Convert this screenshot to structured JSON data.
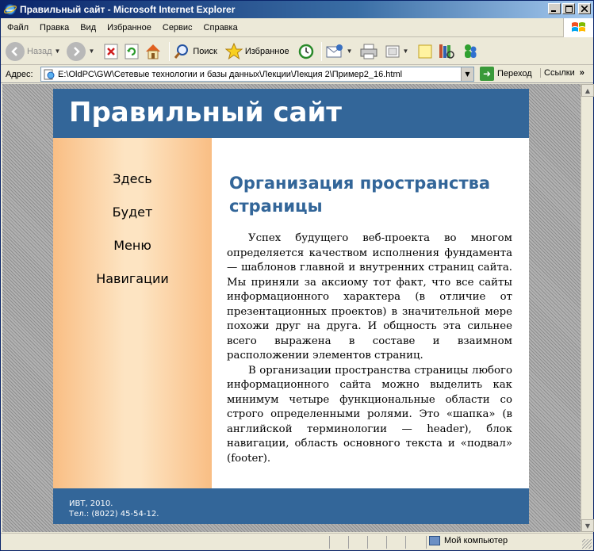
{
  "window": {
    "title": "Правильный сайт - Microsoft Internet Explorer"
  },
  "menu": {
    "items": [
      "Файл",
      "Правка",
      "Вид",
      "Избранное",
      "Сервис",
      "Справка"
    ]
  },
  "toolbar": {
    "back_label": "Назад",
    "search_label": "Поиск",
    "favorites_label": "Избранное"
  },
  "address": {
    "label": "Адрес:",
    "url": "E:\\OldPC\\GW\\Сетевые технологии и базы данных\\Лекции\\Лекция 2\\Пример2_16.html",
    "go_label": "Переход",
    "links_label": "Ссылки"
  },
  "page": {
    "header_title": "Правильный сайт",
    "nav": [
      "Здесь",
      "Будет",
      "Меню",
      "Навигации"
    ],
    "heading": "Организация пространства страницы",
    "paragraphs": [
      "Успех будущего веб-проекта во многом определяется качеством исполнения фундамента — шаблонов главной и внутренних страниц сайта. Мы приняли за аксиому тот факт, что все сайты информационного характера (в отличие от презентационных проектов) в значительной мере похожи друг на друга. И общность эта сильнее всего выражена в составе и взаимном расположении элементов страниц.",
      "В организации пространства страницы любого информационного сайта можно выделить как минимум четыре функциональные области со строго определенными ролями. Это «шапка» (в английской терминологии — header), блок навигации, область основного текста и «подвал» (footer)."
    ],
    "footer": {
      "line1": "ИВТ, 2010.",
      "line2": "Тел.: (8022) 45-54-12."
    }
  },
  "status": {
    "zone": "Мой компьютер"
  },
  "colors": {
    "header_bg": "#336699",
    "heading": "#336699",
    "nav_edge": "#f9be84",
    "nav_center": "#fde4c2"
  }
}
